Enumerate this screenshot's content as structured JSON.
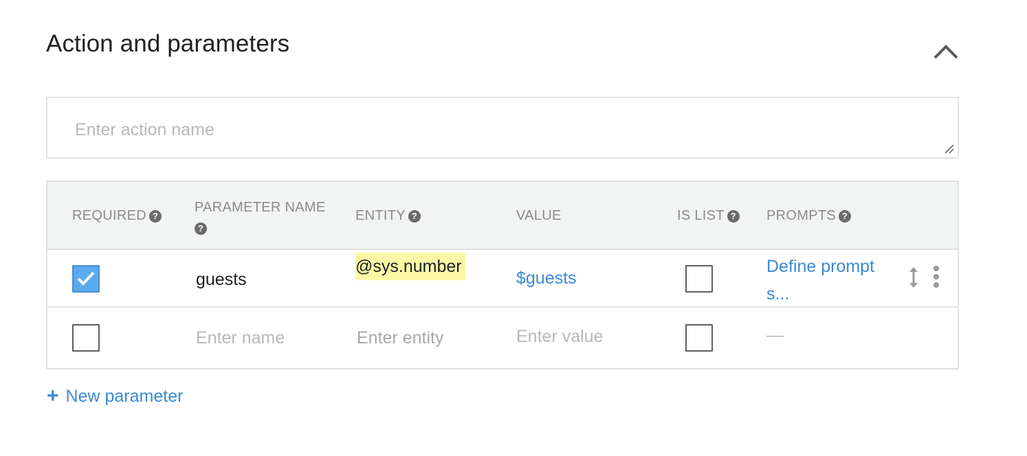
{
  "section": {
    "title": "Action and parameters"
  },
  "action": {
    "placeholder": "Enter action name",
    "value": ""
  },
  "table": {
    "headers": {
      "required": "REQUIRED",
      "parameter_name_line1": "PARAMETER NAME",
      "entity": "ENTITY",
      "value": "VALUE",
      "is_list": "IS LIST",
      "prompts": "PROMPTS"
    },
    "rows": [
      {
        "required": true,
        "parameter_name": "guests",
        "entity": "@sys.number",
        "value": "$guests",
        "is_list": false,
        "prompts": "Define prompts..."
      }
    ],
    "new_row": {
      "required": false,
      "name_placeholder": "Enter name",
      "entity_placeholder": "Enter entity",
      "value_placeholder": "Enter value",
      "is_list": false,
      "prompts": "—"
    }
  },
  "new_parameter": {
    "icon": "+",
    "label": "New parameter"
  },
  "colors": {
    "link": "#3a8ad6",
    "checkbox_checked": "#5aaaf0",
    "entity_highlight": "#fdf8a6",
    "header_bg": "#f2f3f3"
  }
}
